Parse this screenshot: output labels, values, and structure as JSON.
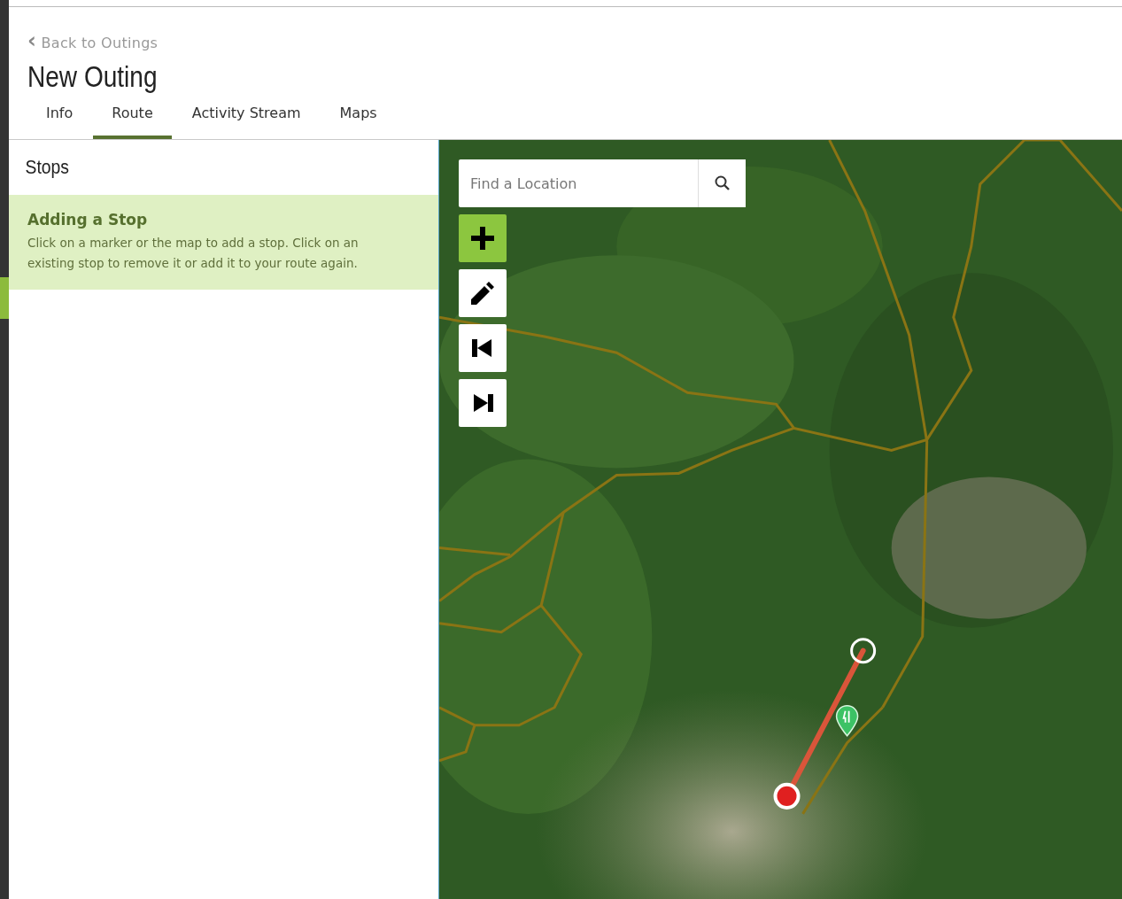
{
  "back_link": {
    "icon": "‹",
    "label": "Back to Outings"
  },
  "title": "New Outing",
  "tabs": [
    {
      "label": "Info",
      "selected": false
    },
    {
      "label": "Route",
      "selected": true
    },
    {
      "label": "Activity Stream",
      "selected": false
    },
    {
      "label": "Maps",
      "selected": false
    }
  ],
  "sidebar": {
    "heading": "Stops",
    "notice": {
      "title": "Adding a Stop",
      "text": "Click on a marker or the map to add a stop. Click on an existing stop to remove it or add it to your route again."
    }
  },
  "map": {
    "search": {
      "placeholder": "Find a Location"
    },
    "tools": [
      {
        "kind": "add",
        "active": true
      },
      {
        "kind": "edit",
        "active": false
      },
      {
        "kind": "first",
        "active": false
      },
      {
        "kind": "last",
        "active": false
      }
    ]
  }
}
